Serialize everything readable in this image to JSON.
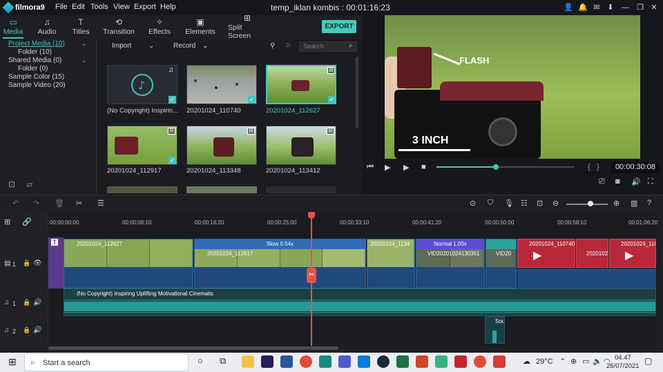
{
  "app": {
    "name": "filmora9",
    "menu": [
      "File",
      "Edit",
      "Tools",
      "View",
      "Export",
      "Help"
    ],
    "window_title": "temp_iklan kombis : 00:01:16:23"
  },
  "tabs": [
    {
      "label": "Media",
      "icon": "folder-icon",
      "active": true
    },
    {
      "label": "Audio",
      "icon": "music-note-icon"
    },
    {
      "label": "Titles",
      "icon": "title-icon"
    },
    {
      "label": "Transition",
      "icon": "transition-icon"
    },
    {
      "label": "Effects",
      "icon": "effects-icon"
    },
    {
      "label": "Elements",
      "icon": "image-icon"
    },
    {
      "label": "Split Screen",
      "icon": "split-screen-icon"
    }
  ],
  "export_label": "EXPORT",
  "library": {
    "items": [
      {
        "label": "Project Media (10)",
        "selected": true
      },
      {
        "label": "Folder (10)"
      },
      {
        "label": "Shared Media (0)"
      },
      {
        "label": "Folder (0)"
      },
      {
        "label": "Sample Color (15)"
      },
      {
        "label": "Sample Video (20)"
      }
    ]
  },
  "media_toolbar": {
    "import": "Import",
    "record": "Record",
    "search_placeholder": "Search"
  },
  "media": [
    {
      "label": "(No Copyright) Inspirin...",
      "kind": "audio"
    },
    {
      "label": "20201024_110740",
      "kind": "video",
      "warning": true
    },
    {
      "label": "20201024_112627",
      "kind": "video",
      "selected": true
    },
    {
      "label": "20201024_112917",
      "kind": "video"
    },
    {
      "label": "20201024_113348",
      "kind": "video"
    },
    {
      "label": "20201024_113412",
      "kind": "video"
    }
  ],
  "preview": {
    "overlay_flash": "FLASH",
    "overlay_size": "3 INCH",
    "timecode": "00:00:30:08",
    "progress": 0.43
  },
  "ruler_ticks": [
    "00:00:00:00",
    "00:00:08:10",
    "00:00:16:20",
    "00:00:25:00",
    "00:00:33:10",
    "00:00:41:20",
    "00:00:50:00",
    "00:00:58:10",
    "00:01:06:20"
  ],
  "timeline": {
    "tracks": [
      {
        "label": "1",
        "type": "video"
      },
      {
        "label": "1",
        "type": "audio"
      },
      {
        "label": "2",
        "type": "audio"
      }
    ],
    "clips": {
      "c1": "20201024_112627",
      "c2_speed": "Slow 0.54x",
      "c2": "20201024_112917",
      "c3": "20201024_1134",
      "c4_speed": "Normal 1.00x",
      "c4": "VID20201024130351",
      "c5": "VID20",
      "c6": "20201024_110740",
      "c7": "2020102",
      "c8": "20201024_110",
      "audio1": "(No Copyright) Inspiring Uplifting Motivational Cinematic",
      "audio2": "Sou"
    }
  },
  "taskbar": {
    "search_placeholder": "Start a search",
    "weather": "29°C",
    "time": "04.47",
    "date": "26/07/2021"
  }
}
